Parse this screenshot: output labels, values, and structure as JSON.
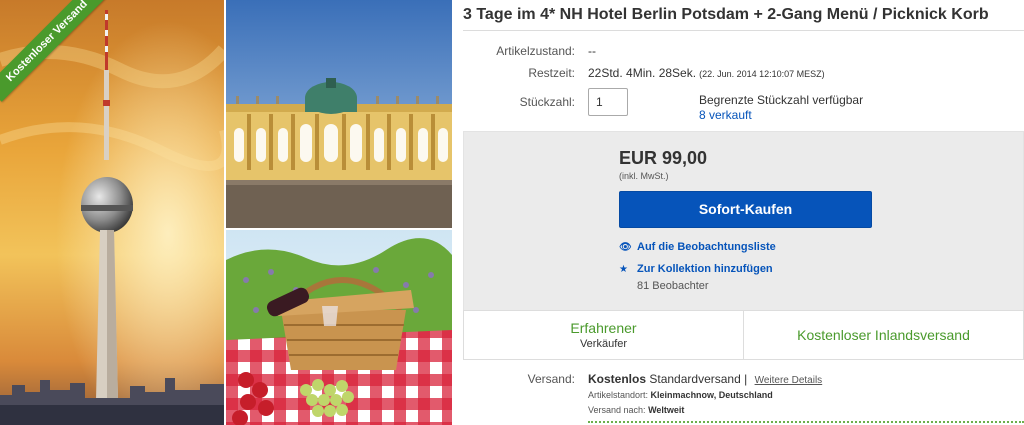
{
  "gallery": {
    "ribbon": "Kostenloser Versand"
  },
  "listing": {
    "title": "3 Tage im 4* NH Hotel Berlin Potsdam + 2-Gang Menü / Picknick Korb",
    "condition_label": "Artikelzustand:",
    "condition_value": "--",
    "time_label": "Restzeit:",
    "time_value": "22Std. 4Min. 28Sek.",
    "time_date": "(22. Jun. 2014   12:10:07 MESZ)",
    "qty_label": "Stückzahl:",
    "qty_value": "1",
    "qty_available": "Begrenzte Stückzahl verfügbar",
    "qty_sold": "8 verkauft"
  },
  "buybox": {
    "price": "EUR 99,00",
    "vat": "(inkl. MwSt.)",
    "buy_label": "Sofort-Kaufen",
    "watch_label": "Auf die Beobachtungsliste",
    "collection_label": "Zur Kollektion hinzufügen",
    "watchers": "81 Beobachter"
  },
  "features": {
    "seller_main": "Erfahrener",
    "seller_sub": "Verkäufer",
    "shipping_main": "Kostenloser Inlandsversand"
  },
  "shipping": {
    "label": "Versand:",
    "cost": "Kostenlos",
    "method": "Standardversand |",
    "details_link": "Weitere Details",
    "location_label": "Artikelstandort:",
    "location_value": "Kleinmachnow, Deutschland",
    "ships_to_label": "Versand nach:",
    "ships_to_value": "Weltweit"
  },
  "colors": {
    "accent_blue": "#0654ba",
    "green": "#4a9a2c"
  }
}
